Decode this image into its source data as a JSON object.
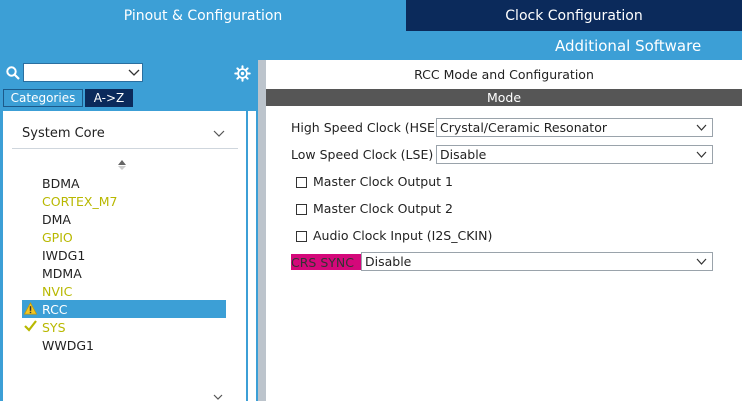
{
  "tabs": {
    "pinout": "Pinout & Configuration",
    "clock": "Clock Configuration",
    "additional": "Additional Software"
  },
  "left": {
    "search_value": "",
    "tab_categories": "Categories",
    "tab_az": "A->Z",
    "group_label": "System Core",
    "items": [
      {
        "label": "BDMA",
        "status": "none"
      },
      {
        "label": "CORTEX_M7",
        "status": "ok"
      },
      {
        "label": "DMA",
        "status": "none"
      },
      {
        "label": "GPIO",
        "status": "ok"
      },
      {
        "label": "IWDG1",
        "status": "none"
      },
      {
        "label": "MDMA",
        "status": "none"
      },
      {
        "label": "NVIC",
        "status": "ok"
      },
      {
        "label": "RCC",
        "status": "warning-selected"
      },
      {
        "label": "SYS",
        "status": "checked"
      },
      {
        "label": "WWDG1",
        "status": "none"
      }
    ]
  },
  "right": {
    "title": "RCC Mode and Configuration",
    "mode_header": "Mode",
    "hse_label": "High Speed Clock (HSE)",
    "hse_value": "Crystal/Ceramic Resonator",
    "lse_label": "Low Speed Clock (LSE)",
    "lse_value": "Disable",
    "mco1_label": "Master Clock Output 1",
    "mco2_label": "Master Clock Output 2",
    "audio_label": "Audio Clock Input (I2S_CKIN)",
    "crs_label": "CRS SYNC",
    "crs_value": "Disable"
  },
  "colors": {
    "accent_blue": "#3c9fd6",
    "navy": "#0b2a5b",
    "ok_yellow": "#b8b800",
    "crs_magenta": "#d4087a"
  }
}
